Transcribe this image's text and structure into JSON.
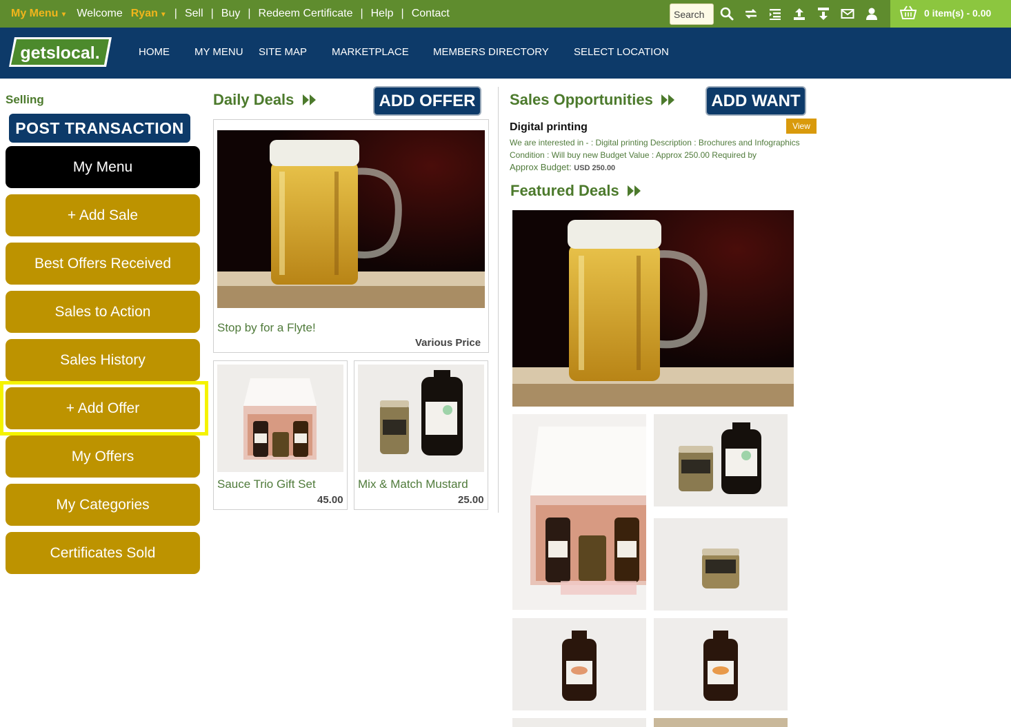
{
  "topbar": {
    "my_menu": "My Menu",
    "welcome": "Welcome",
    "user": "Ryan",
    "links": [
      "Sell",
      "Buy",
      "Redeem Certificate",
      "Help",
      "Contact"
    ],
    "search_placeholder": "Search",
    "icons": [
      "search-icon",
      "exchange-icon",
      "list-icon",
      "upload-icon",
      "download-icon",
      "mail-icon",
      "user-icon"
    ],
    "cart_text": "0 item(s) - 0.00"
  },
  "nav": {
    "logo": "getslocal.",
    "items": [
      "HOME",
      "MY MENU",
      "SITE MAP",
      "MARKETPLACE",
      "MEMBERS DIRECTORY",
      "SELECT LOCATION"
    ]
  },
  "sidebar": {
    "heading": "Selling",
    "post_button": "POST TRANSACTION",
    "items": [
      "My Menu",
      "+ Add Sale",
      "Best Offers Received",
      "Sales to Action",
      "Sales History",
      "+ Add Offer",
      "My Offers",
      "My Categories",
      "Certificates Sold"
    ],
    "highlighted_item": "+ Add Offer"
  },
  "daily_deals": {
    "title": "Daily Deals",
    "add_button": "ADD OFFER",
    "featured": {
      "title": "Stop by for a Flyte!",
      "price": "Various Price"
    },
    "items": [
      {
        "title": "Sauce Trio Gift Set",
        "price": "45.00"
      },
      {
        "title": "Mix & Match Mustard",
        "price": "25.00"
      }
    ]
  },
  "opportunities": {
    "title": "Sales Opportunities",
    "add_button": "ADD WANT",
    "item": {
      "title": "Digital printing",
      "view_label": "View",
      "description": "We are interested in - : Digital printing Description : Brochures and Infographics Condition : Will buy new Budget Value : Approx 250.00 Required by",
      "budget_label": "Approx Budget:",
      "budget_value": "USD 250.00"
    }
  },
  "featured_deals": {
    "title": "Featured Deals"
  },
  "colors": {
    "topbar": "#5f8c2e",
    "navbar": "#0d3a69",
    "cart": "#8cc63f",
    "side_button": "#bd9300",
    "heading_green": "#4c7a2c",
    "highlight": "#f5f300"
  }
}
